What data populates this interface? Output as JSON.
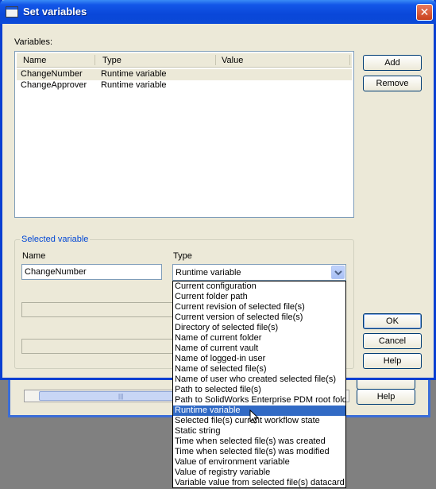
{
  "dialog": {
    "title": "Set variables",
    "variables_label": "Variables:",
    "columns": [
      "Name",
      "Type",
      "Value"
    ],
    "variables": [
      {
        "name": "ChangeNumber",
        "type": "Runtime variable",
        "value": ""
      },
      {
        "name": "ChangeApprover",
        "type": "Runtime variable",
        "value": ""
      }
    ],
    "add_label": "Add",
    "remove_label": "Remove",
    "selected_group_label": "Selected variable",
    "name_label": "Name",
    "type_label": "Type",
    "name_value": "ChangeNumber",
    "type_value": "Runtime variable",
    "ok_label": "OK",
    "cancel_label": "Cancel",
    "help_label": "Help"
  },
  "type_options": [
    "Current configuration",
    "Current folder path",
    "Current revision of selected file(s)",
    "Current version of selected file(s)",
    "Directory of selected file(s)",
    "Name of current folder",
    "Name of current vault",
    "Name of logged-in user",
    "Name of selected file(s)",
    "Name of user who created selected file(s)",
    "Path to selected file(s)",
    "Path to SolidWorks Enterprise PDM root folde",
    "Runtime variable",
    "Selected file(s) current workflow state",
    "Static string",
    "Time when selected file(s) was created",
    "Time when selected file(s) was modified",
    "Value of environment variable",
    "Value of registry variable",
    "Variable value from selected file(s) datacard"
  ],
  "selected_option_index": 12,
  "background_window": {
    "help_label": "Help"
  },
  "icons": {
    "close": "close-icon",
    "dropdown": "chevron-down-icon",
    "cursor": "mouse-pointer-icon"
  }
}
